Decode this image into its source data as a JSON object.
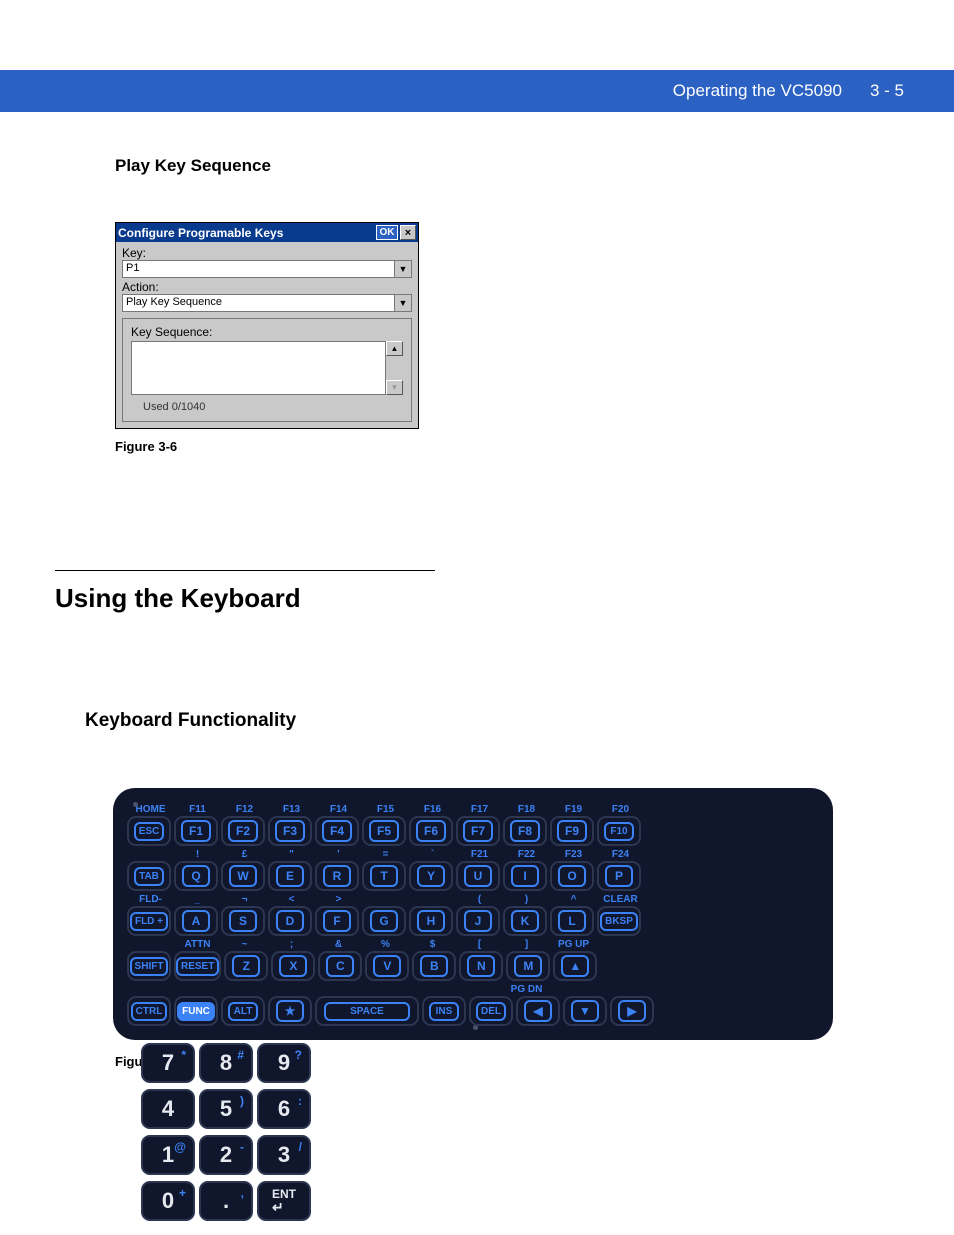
{
  "header": {
    "title": "Operating the VC5090",
    "page": "3 - 5"
  },
  "section1": {
    "heading": "Play Key Sequence"
  },
  "dialog": {
    "title": "Configure Programable Keys",
    "ok": "OK",
    "close": "×",
    "key_label": "Key:",
    "key_value": "P1",
    "action_label": "Action:",
    "action_value": "Play Key Sequence",
    "seq_label": "Key Sequence:",
    "used": "Used  0/1040"
  },
  "fig1": "Figure 3-6",
  "h1": "Using the Keyboard",
  "h2": "Keyboard Functionality",
  "fig2": "Figure 3-7",
  "kb": {
    "top_labels": [
      "HOME",
      "F11",
      "F12",
      "F13",
      "F14",
      "F15",
      "F16",
      "F17",
      "F18",
      "F19",
      "F20"
    ],
    "row1": [
      "ESC",
      "F1",
      "F2",
      "F3",
      "F4",
      "F5",
      "F6",
      "F7",
      "F8",
      "F9",
      "F10"
    ],
    "mid1": [
      "",
      "!",
      "£",
      "\"",
      "'",
      "=",
      "`",
      "F21",
      "F22",
      "F23",
      "F24"
    ],
    "row2": [
      "TAB",
      "Q",
      "W",
      "E",
      "R",
      "T",
      "Y",
      "U",
      "I",
      "O",
      "P"
    ],
    "mid2": [
      "FLD-",
      "_",
      "¬",
      "<",
      ">",
      "",
      "",
      "(",
      ")",
      "^",
      "CLEAR"
    ],
    "row3": [
      "FLD +",
      "A",
      "S",
      "D",
      "F",
      "G",
      "H",
      "J",
      "K",
      "L",
      "BKSP"
    ],
    "mid3": [
      "",
      "ATTN",
      "~",
      ";",
      "&",
      "%",
      "$",
      "[",
      "]",
      "PG UP",
      ""
    ],
    "row4": [
      "SHIFT",
      "RESET",
      "Z",
      "X",
      "C",
      "V",
      "B",
      "N",
      "M",
      "▲"
    ],
    "mid4": [
      "",
      "",
      "",
      "",
      "",
      "",
      "",
      "",
      "PG DN",
      ""
    ],
    "row5": [
      "CTRL",
      "FUNC",
      "ALT",
      "★",
      "SPACE",
      "INS",
      "DEL",
      "◀",
      "▼",
      "▶"
    ],
    "numpad": [
      {
        "n": "7",
        "s": "*"
      },
      {
        "n": "8",
        "s": "#"
      },
      {
        "n": "9",
        "s": "?"
      },
      {
        "n": "4",
        "s": ""
      },
      {
        "n": "5",
        "s": ")"
      },
      {
        "n": "6",
        "s": ":"
      },
      {
        "n": "1",
        "s": "@"
      },
      {
        "n": "2",
        "s": "-"
      },
      {
        "n": "3",
        "s": "/"
      },
      {
        "n": "0",
        "s": "+"
      },
      {
        "n": ".",
        "s": ","
      },
      {
        "n": "ENT",
        "s": ""
      }
    ]
  }
}
